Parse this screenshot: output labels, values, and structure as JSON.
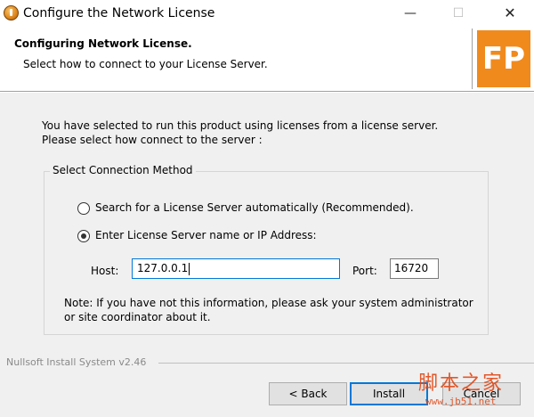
{
  "window": {
    "title": "Configure the Network License",
    "minimize_glyph": "—",
    "maximize_glyph": "☐",
    "close_glyph": "✕",
    "icon": "installer-icon"
  },
  "header": {
    "title": "Configuring Network License.",
    "subtitle": "Select how to connect to your License Server.",
    "logo_text": "FP",
    "logo_color": "#f08a1d"
  },
  "body": {
    "intro_line1": "You have selected to run this product using licenses from a license server.",
    "intro_line2": "Please select how connect to the server :"
  },
  "connection": {
    "group_label": "Select Connection Method",
    "options": [
      {
        "label": "Search for a License Server automatically (Recommended).",
        "selected": false
      },
      {
        "label": "Enter License Server name or IP Address:",
        "selected": true
      }
    ],
    "host_label": "Host:",
    "host_value": "127.0.0.1",
    "port_label": "Port:",
    "port_value": "16720",
    "note": "Note: If you have not this information, please ask your system administrator or site coordinator about it."
  },
  "footer": {
    "brand": "Nullsoft Install System v2.46",
    "back_label": "< Back",
    "install_label": "Install",
    "cancel_label": "Cancel"
  },
  "watermark": {
    "text_cn": "脚本之家",
    "url": "www.jb51.net",
    "color": "#e24b1a"
  }
}
